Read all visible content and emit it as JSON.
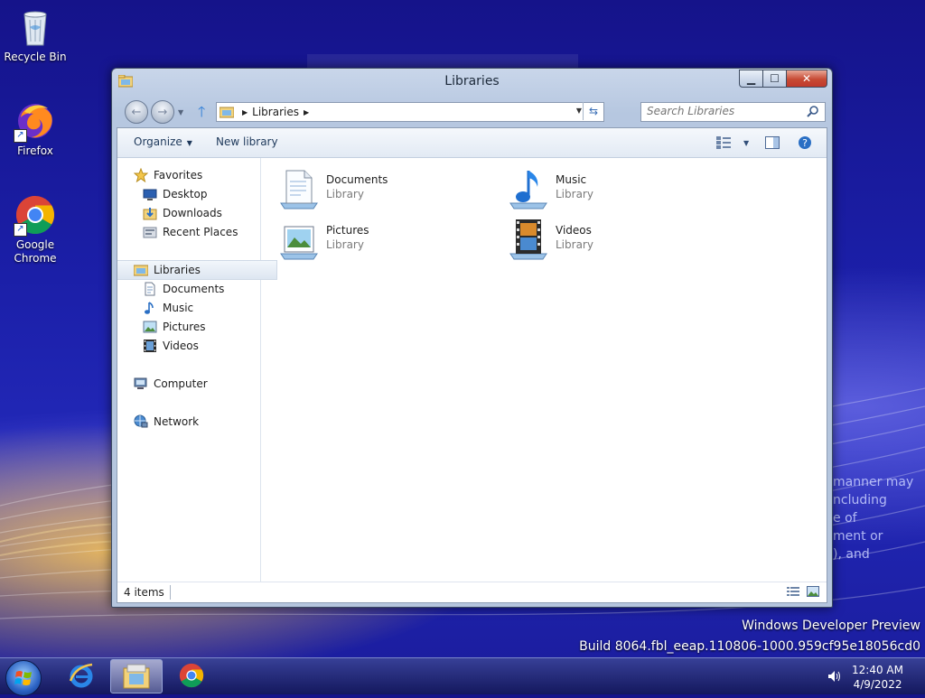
{
  "desktop": {
    "icons": [
      {
        "label": "Recycle Bin",
        "icon": "recycle-bin-icon"
      },
      {
        "label": "Firefox",
        "icon": "firefox-icon"
      },
      {
        "label": "Google Chrome",
        "icon": "chrome-icon"
      }
    ],
    "watermark": {
      "line1": "Windows Developer Preview",
      "line2": "Build 8064.fbl_eeap.110806-1000.959cf95e18056cd0"
    },
    "background_text": [
      "manner may",
      "ncluding",
      "e of",
      "ment or",
      "), and"
    ]
  },
  "window": {
    "title": "Libraries",
    "address": {
      "crumbs": [
        "Libraries"
      ]
    },
    "search": {
      "placeholder": "Search Libraries"
    },
    "toolbar": {
      "organize": "Organize",
      "new_library": "New library"
    },
    "nav": {
      "favorites": {
        "label": "Favorites",
        "items": [
          "Desktop",
          "Downloads",
          "Recent Places"
        ]
      },
      "libraries": {
        "label": "Libraries",
        "items": [
          "Documents",
          "Music",
          "Pictures",
          "Videos"
        ]
      },
      "computer": "Computer",
      "network": "Network"
    },
    "items": [
      {
        "name": "Documents",
        "type": "Library"
      },
      {
        "name": "Music",
        "type": "Library"
      },
      {
        "name": "Pictures",
        "type": "Library"
      },
      {
        "name": "Videos",
        "type": "Library"
      }
    ],
    "status": {
      "count": "4 items"
    }
  },
  "taskbar": {
    "apps": [
      "start-button",
      "internet-explorer",
      "windows-explorer",
      "google-chrome"
    ],
    "clock": {
      "time": "12:40 AM",
      "date": "4/9/2022"
    }
  },
  "colors": {
    "accent": "#1e395b",
    "selection": "#dde6f1",
    "close": "#c74a34"
  }
}
